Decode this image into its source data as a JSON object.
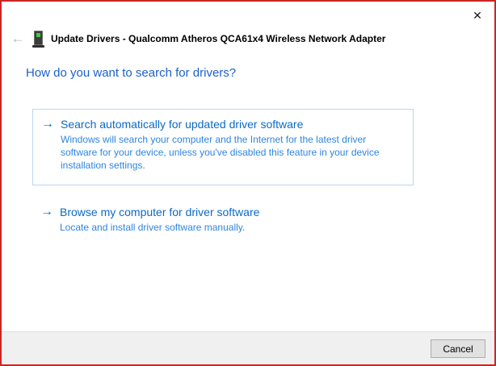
{
  "window": {
    "title": "Update Drivers - Qualcomm Atheros QCA61x4 Wireless Network Adapter",
    "close_glyph": "✕",
    "back_glyph": "←",
    "border_color": "#cc2523"
  },
  "heading": "How do you want to search for drivers?",
  "options": [
    {
      "arrow_glyph": "→",
      "title": "Search automatically for updated driver software",
      "description": "Windows will search your computer and the Internet for the latest driver software for your device, unless you've disabled this feature in your device installation settings.",
      "focused": true
    },
    {
      "arrow_glyph": "→",
      "title": "Browse my computer for driver software",
      "description": "Locate and install driver software manually.",
      "focused": false
    }
  ],
  "footer": {
    "cancel_label": "Cancel"
  },
  "colors": {
    "heading_blue": "#1d60c8",
    "link_blue": "#0c6ac4",
    "description_blue": "#2e85dd",
    "focus_border": "#b9d7f2",
    "footer_bg": "#f0f0f0",
    "button_bg": "#e1e1e1",
    "button_border": "#adadad",
    "led_green": "#3ecb3e"
  }
}
